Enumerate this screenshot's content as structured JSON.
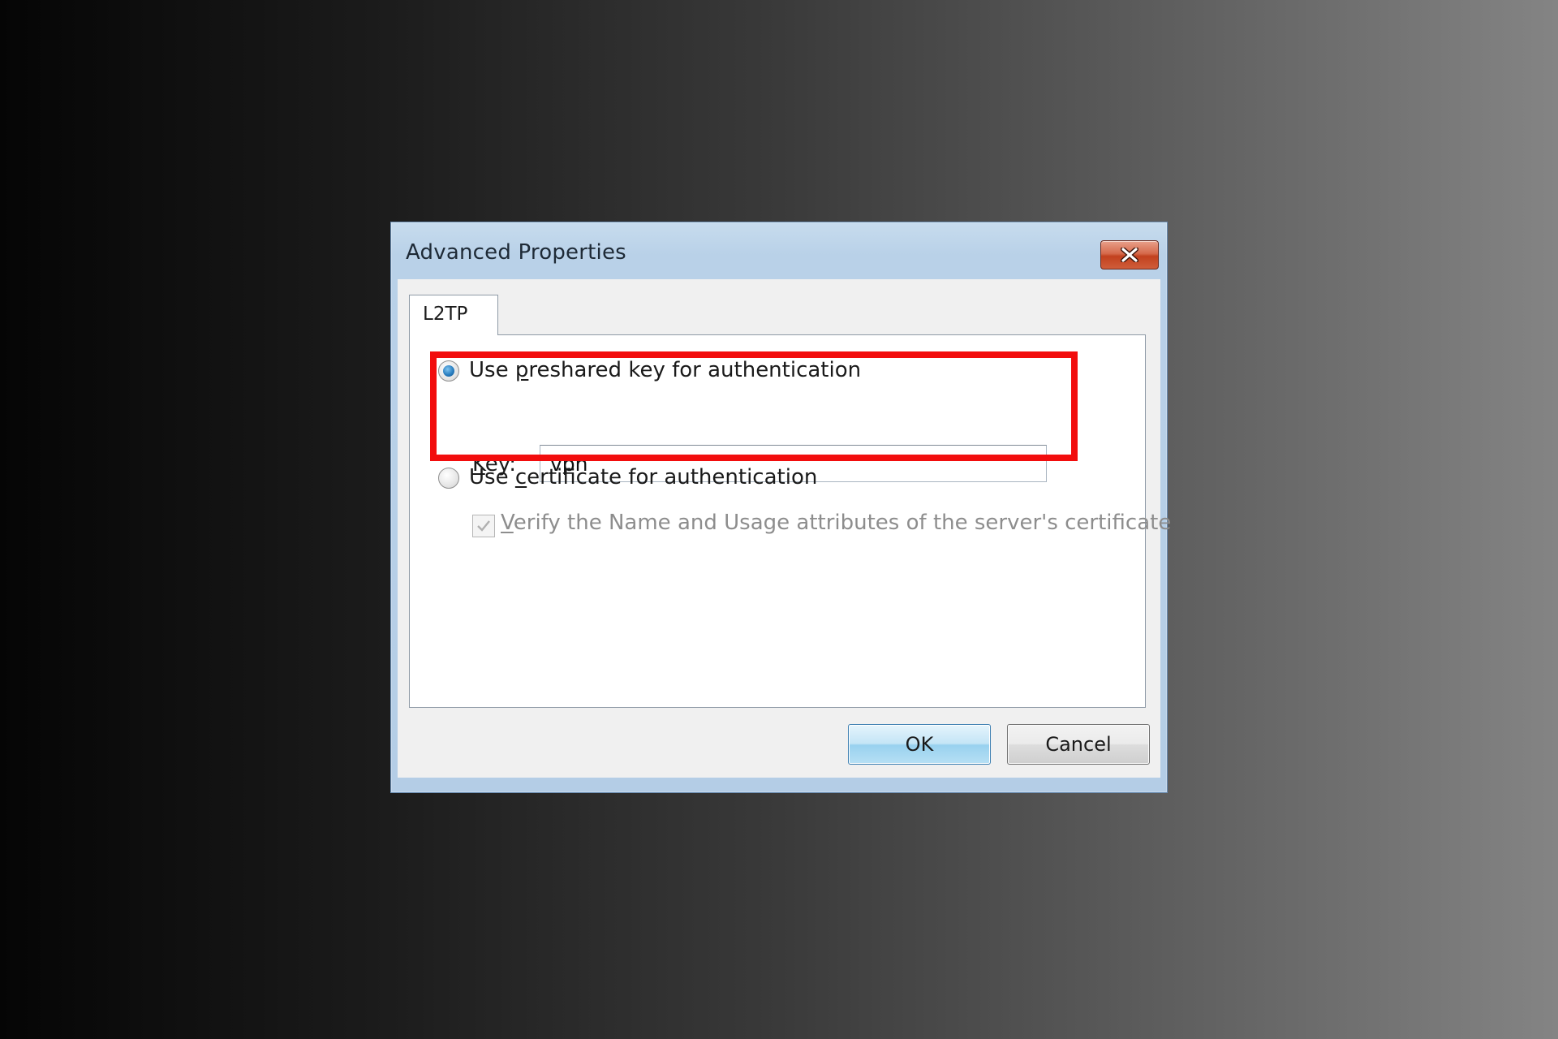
{
  "window": {
    "title": "Advanced Properties",
    "close_icon": "close-icon"
  },
  "tabs": [
    {
      "label": "L2TP",
      "selected": true
    }
  ],
  "options": {
    "preshared": {
      "prefix": "Use ",
      "accel": "p",
      "rest": "reshared key for authentication",
      "selected": true
    },
    "key": {
      "accel": "K",
      "rest": "ey:",
      "value": "vpn"
    },
    "certificate": {
      "prefix": "Use ",
      "accel": "c",
      "rest": "ertificate for authentication",
      "selected": false
    },
    "verify": {
      "accel": "V",
      "rest": "erify the Name and Usage attributes of the server's certificate",
      "checked": true,
      "enabled": false
    }
  },
  "buttons": {
    "ok": "OK",
    "cancel": "Cancel"
  },
  "colors": {
    "highlight": "#f20d0d",
    "titlebar": "#b9d1e8",
    "close_button": "#c2411e"
  }
}
